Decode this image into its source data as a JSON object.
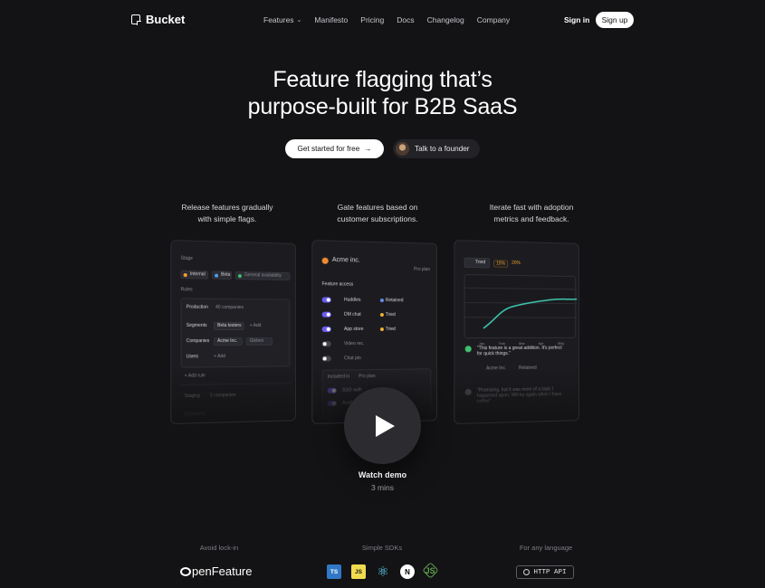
{
  "brand": {
    "name": "Bucket"
  },
  "nav": {
    "links": [
      "Features",
      "Manifesto",
      "Pricing",
      "Docs",
      "Changelog",
      "Company"
    ],
    "sign_in": "Sign in",
    "sign_up": "Sign up"
  },
  "hero": {
    "title_line1": "Feature flagging that’s",
    "title_line2": "purpose-built for B2B SaaS",
    "cta_primary": "Get started for free",
    "cta_secondary": "Talk to a founder"
  },
  "features": [
    {
      "caption_line1": "Release features gradually",
      "caption_line2": "with simple flags."
    },
    {
      "caption_line1": "Gate features based on",
      "caption_line2": "customer subscriptions."
    },
    {
      "caption_line1": "Iterate fast with adoption",
      "caption_line2": "metrics and feedback."
    }
  ],
  "panel_release": {
    "stage_label": "Stage",
    "stages": [
      "Internal",
      "Beta",
      "General availability"
    ],
    "rules_label": "Rules",
    "env": "Production",
    "env_count": "40 companies",
    "segments_label": "Segments",
    "segment_value": "Beta testers",
    "add": "+ Add",
    "companies_label": "Companies",
    "company_value": "Acme Inc.",
    "company_value2": "Globex",
    "users_label": "Users",
    "add_rule": "+ Add rule",
    "env2": "Staging",
    "env2_count": "5 companies",
    "env3": "Segments"
  },
  "panel_gate": {
    "company": "Acme inc.",
    "plan_badge": "Pro plan",
    "section": "Feature access",
    "features": [
      {
        "name": "Huddles",
        "on": true,
        "status": "Retained"
      },
      {
        "name": "DM chat",
        "on": true,
        "status": "Tried"
      },
      {
        "name": "App store",
        "on": true,
        "status": "Tried"
      },
      {
        "name": "Video rec.",
        "on": false,
        "status": ""
      },
      {
        "name": "Chat pin",
        "on": false,
        "status": ""
      }
    ],
    "included_label": "Included in",
    "included_plan": "Pro plan",
    "sub_features": [
      "SSO auth",
      "Audit logs"
    ]
  },
  "panel_metrics": {
    "tab": "Tried",
    "badge": "15%",
    "badge2": "20%",
    "axis": [
      "Jan",
      "Feb",
      "Mar",
      "Apr",
      "May"
    ],
    "feedback1": "\"This feature is a great addition. It's perfect for quick things.\"",
    "feedback1_company": "Acme Inc.",
    "feedback1_status": "Retained",
    "feedback2": "\"Promising, but it was more of a topic I happened upon. Will try again when I have coffee\""
  },
  "video": {
    "label": "Watch demo",
    "duration": "3 mins"
  },
  "bottom": {
    "lockin_label": "Avoid lock-in",
    "openfeature": "penFeature",
    "sdks_label": "Simple SDKs",
    "sdks": [
      "TS",
      "JS",
      "⚛",
      "N",
      "JS"
    ],
    "language_label": "For any language",
    "http_api": "HTTP API"
  },
  "colors": {
    "background": "#131315",
    "accent": "#6a5cf0",
    "chart_line": "#3fc8b0"
  }
}
